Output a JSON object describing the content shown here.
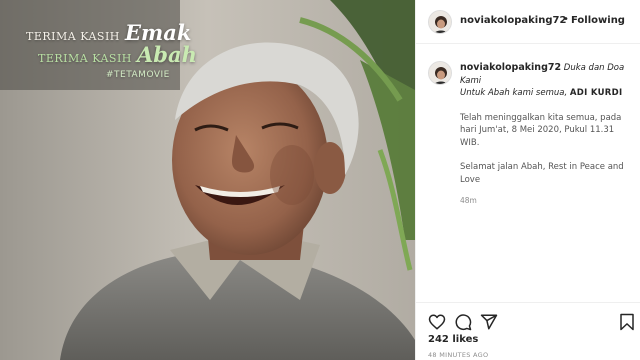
{
  "photo": {
    "overlay": {
      "line1_small": "TERIMA KASIH",
      "line1_script": "Emak",
      "line2_small": "TERIMA KASIH",
      "line2_script": "Abah",
      "hashtag": "#TETAMOVIE"
    }
  },
  "header": {
    "username": "noviakolopaking72",
    "separator": "•",
    "follow_status": "Following"
  },
  "caption": {
    "username": "noviakolopaking72",
    "line1": "Duka dan Doa",
    "line2": "Kami",
    "line3_prefix": "Untuk Abah kami semua,",
    "line3_name": "ADI KURDI",
    "paragraph1": "Telah meninggalkan kita semua, pada hari Jum'at, 8 Mei 2020, Pukul 11.31 WIB.",
    "paragraph2": "Selamat jalan Abah, Rest in Peace and Love",
    "time": "48m"
  },
  "actions": {
    "like_icon": "heart-icon",
    "comment_icon": "comment-icon",
    "share_icon": "share-icon",
    "save_icon": "bookmark-icon"
  },
  "likes": "242 likes",
  "posted_ago": "48 MINUTES AGO",
  "colors": {
    "text_primary": "#262626",
    "text_secondary": "#8e8e8e",
    "divider": "#efefef"
  }
}
